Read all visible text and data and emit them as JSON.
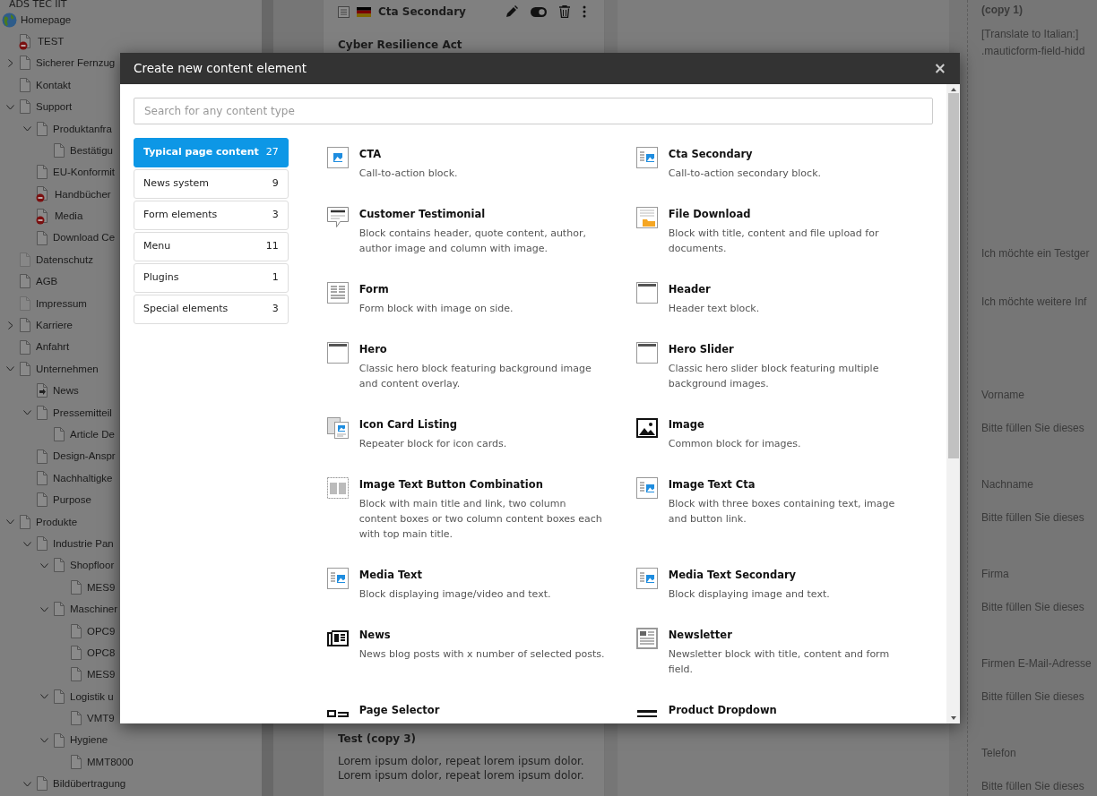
{
  "tree": {
    "site": "ADS TEC IIT",
    "items": [
      {
        "label": "Homepage",
        "kind": "globe",
        "children": [
          {
            "label": "TEST",
            "kind": "restricted"
          },
          {
            "label": "Sicherer Fernzug",
            "kind": "page",
            "expanded": false
          },
          {
            "label": "Kontakt",
            "kind": "page"
          },
          {
            "label": "Support",
            "kind": "page",
            "expanded": true,
            "children": [
              {
                "label": "Produktanfra",
                "kind": "page",
                "expanded": true,
                "children": [
                  {
                    "label": "Bestätigu",
                    "kind": "page"
                  }
                ]
              },
              {
                "label": "EU-Konformit",
                "kind": "page"
              },
              {
                "label": "Handbücher",
                "kind": "restricted"
              },
              {
                "label": "Media",
                "kind": "restricted"
              },
              {
                "label": "Download Ce",
                "kind": "page"
              }
            ]
          },
          {
            "label": "Datenschutz",
            "kind": "faded"
          },
          {
            "label": "AGB",
            "kind": "page"
          },
          {
            "label": "Impressum",
            "kind": "faded"
          },
          {
            "label": "Karriere",
            "kind": "page",
            "expanded": false
          },
          {
            "label": "Anfahrt",
            "kind": "page"
          },
          {
            "label": "Unternehmen",
            "kind": "page",
            "expanded": true,
            "children": [
              {
                "label": "News",
                "kind": "shortcut"
              },
              {
                "label": "Pressemitteil",
                "kind": "page",
                "expanded": true,
                "children": [
                  {
                    "label": "Article De",
                    "kind": "page"
                  }
                ]
              },
              {
                "label": "Design-Anspr",
                "kind": "page"
              },
              {
                "label": "Nachhaltigke",
                "kind": "page"
              },
              {
                "label": "Purpose",
                "kind": "page"
              }
            ]
          },
          {
            "label": "Produkte",
            "kind": "page",
            "expanded": true,
            "children": [
              {
                "label": "Industrie Pan",
                "kind": "page",
                "expanded": true,
                "children": [
                  {
                    "label": "Shopfloor",
                    "kind": "page",
                    "expanded": true,
                    "children": [
                      {
                        "label": "MES9",
                        "kind": "page"
                      }
                    ]
                  },
                  {
                    "label": "Maschiner",
                    "kind": "page",
                    "expanded": true,
                    "children": [
                      {
                        "label": "OPC9",
                        "kind": "page"
                      },
                      {
                        "label": "OPC8",
                        "kind": "page"
                      },
                      {
                        "label": "MES9",
                        "kind": "page"
                      }
                    ]
                  },
                  {
                    "label": "Logistik u",
                    "kind": "page",
                    "expanded": true,
                    "children": [
                      {
                        "label": "VMT9",
                        "kind": "page"
                      }
                    ]
                  },
                  {
                    "label": "Hygiene",
                    "kind": "page",
                    "expanded": true,
                    "children": [
                      {
                        "label": "MMT8000",
                        "kind": "page"
                      }
                    ]
                  }
                ]
              },
              {
                "label": "Bildübertragung",
                "kind": "page",
                "expanded": true
              }
            ]
          }
        ]
      }
    ]
  },
  "content": {
    "top_card": {
      "type_title": "Cta Secondary",
      "heading": "Cyber Resilience Act"
    },
    "bottom_card": {
      "heading": "Test (copy 3)",
      "lines": [
        "Lorem ipsum dolor, repeat lorem ipsum dolor.",
        "Lorem ipsum dolor, repeat lorem ipsum dolor."
      ]
    }
  },
  "right_panel": {
    "heading": "(copy 1)",
    "lines": [
      "[Translate to Italian:]",
      ".mauticform-field-hidd"
    ],
    "options": [
      "Ich möchte ein Testger",
      "Ich möchte weitere Inf"
    ],
    "fields": [
      {
        "label": "Vorname",
        "hint": "Bitte füllen Sie dieses"
      },
      {
        "label": "Nachname",
        "hint": "Bitte füllen Sie dieses"
      },
      {
        "label": "Firma",
        "hint": "Bitte füllen Sie dieses"
      },
      {
        "label": "Firmen E-Mail-Adresse",
        "hint": "Bitte füllen Sie dieses"
      },
      {
        "label": "Telefon",
        "hint": "Bitte füllen Sie dieses"
      }
    ]
  },
  "modal": {
    "title": "Create new content element",
    "close": "×",
    "search": {
      "placeholder": "Search for any content type"
    },
    "categories": [
      {
        "label": "Typical page content",
        "count": "27",
        "selected": true
      },
      {
        "label": "News system",
        "count": "9",
        "selected": false
      },
      {
        "label": "Form elements",
        "count": "3",
        "selected": false
      },
      {
        "label": "Menu",
        "count": "11",
        "selected": false
      },
      {
        "label": "Plugins",
        "count": "1",
        "selected": false
      },
      {
        "label": "Special elements",
        "count": "3",
        "selected": false
      }
    ],
    "elements": [
      {
        "title": "CTA",
        "description": "Call-to-action block.",
        "kind": "cta"
      },
      {
        "title": "Cta Secondary",
        "description": "Call-to-action secondary block.",
        "kind": "media"
      },
      {
        "title": "Customer Testimonial",
        "description": "Block contains header, quote content, author, author image and column with image.",
        "kind": "bubble"
      },
      {
        "title": "File Download",
        "description": "Block with title, content and file upload for documents.",
        "kind": "file"
      },
      {
        "title": "Form",
        "description": "Form block with image on side.",
        "kind": "form"
      },
      {
        "title": "Header",
        "description": "Header text block.",
        "kind": "header"
      },
      {
        "title": "Hero",
        "description": "Classic hero block featuring background image and content overlay.",
        "kind": "header"
      },
      {
        "title": "Hero Slider",
        "description": "Classic hero slider block featuring multiple background images.",
        "kind": "header"
      },
      {
        "title": "Icon Card Listing",
        "description": "Repeater block for icon cards.",
        "kind": "cards"
      },
      {
        "title": "Image",
        "description": "Common block for images.",
        "kind": "image"
      },
      {
        "title": "Image Text Button Combination",
        "description": "Block with main title and link, two column content boxes or two column content boxes each with top main title.",
        "kind": "columns"
      },
      {
        "title": "Image Text Cta",
        "description": "Block with three boxes containing text, image and button link.",
        "kind": "media"
      },
      {
        "title": "Media Text",
        "description": "Block displaying image/video and text.",
        "kind": "media"
      },
      {
        "title": "Media Text Secondary",
        "description": "Block displaying image and text.",
        "kind": "media"
      },
      {
        "title": "News",
        "description": "News blog posts with x number of selected posts.",
        "kind": "news"
      },
      {
        "title": "Newsletter",
        "description": "Newsletter block with title, content and form field.",
        "kind": "newsletter"
      },
      {
        "title": "Page Selector",
        "kind": "selector"
      },
      {
        "title": "Product Dropdown",
        "kind": "bars"
      }
    ]
  }
}
